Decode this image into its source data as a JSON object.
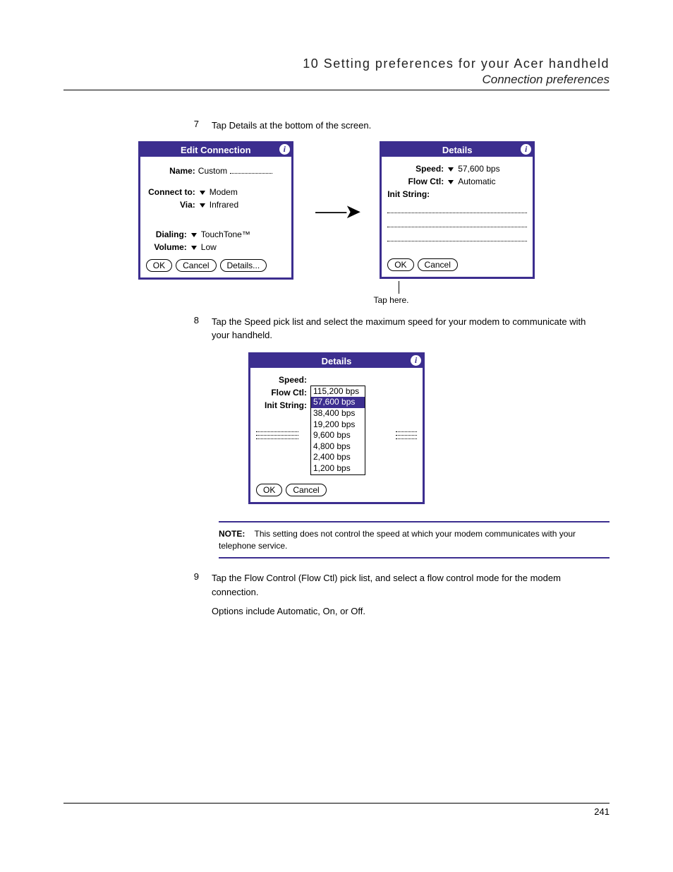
{
  "header": {
    "chapter": "10 Setting preferences for your Acer handheld",
    "section": "Connection preferences"
  },
  "steps": {
    "s7": {
      "num": "7",
      "text": "Tap Details at the bottom of the screen."
    },
    "s8": {
      "num": "8",
      "text": "Tap the Speed pick list and select the maximum speed for your modem to communicate with your handheld."
    },
    "s9": {
      "num": "9",
      "text": "Tap the Flow Control (Flow Ctl) pick list, and select a flow control mode for the modem connection.",
      "text2": "Options include Automatic, On, or Off."
    }
  },
  "fig1": {
    "left": {
      "title": "Edit Connection",
      "name_label": "Name:",
      "name_value": "Custom",
      "connect_label": "Connect to:",
      "connect_value": "Modem",
      "via_label": "Via:",
      "via_value": "Infrared",
      "dialing_label": "Dialing:",
      "dialing_value": "TouchTone™",
      "volume_label": "Volume:",
      "volume_value": "Low",
      "ok": "OK",
      "cancel": "Cancel",
      "details": "Details..."
    },
    "right": {
      "title": "Details",
      "speed_label": "Speed:",
      "speed_value": "57,600 bps",
      "flow_label": "Flow Ctl:",
      "flow_value": "Automatic",
      "init_label": "Init String:",
      "ok": "OK",
      "cancel": "Cancel"
    },
    "callout": "Tap here."
  },
  "fig2": {
    "title": "Details",
    "speed_label": "Speed:",
    "flow_label": "Flow Ctl:",
    "init_label": "Init String:",
    "options": [
      "115,200 bps",
      "57,600 bps",
      "38,400 bps",
      "19,200 bps",
      "9,600 bps",
      "4,800 bps",
      "2,400 bps",
      "1,200 bps"
    ],
    "ok": "OK",
    "cancel": "Cancel"
  },
  "note": {
    "label": "NOTE:",
    "text": "This setting does not control the speed at which your modem communicates with your telephone service."
  },
  "page_number": "241"
}
